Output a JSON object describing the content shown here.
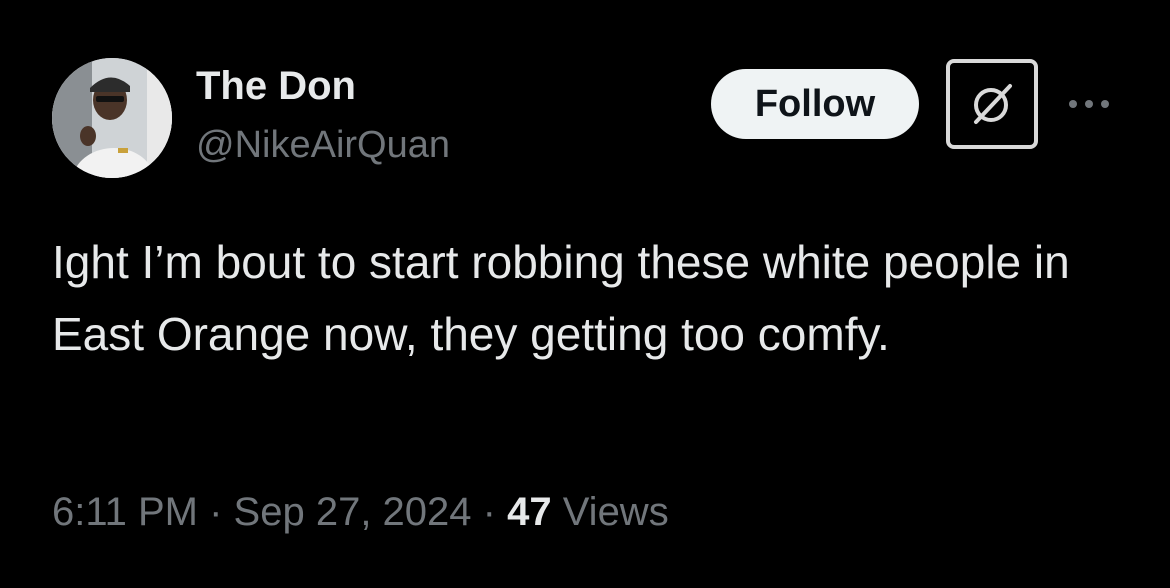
{
  "user": {
    "display_name": "The Don",
    "handle": "@NikeAirQuan",
    "avatar_icon": "profile-photo"
  },
  "actions": {
    "follow_label": "Follow",
    "grok_icon": "grok-icon",
    "more_icon": "more-horizontal-icon"
  },
  "tweet": {
    "text": "Ight I’m bout to start robbing these white people in East Orange now, they getting too comfy.",
    "time": "6:11 PM",
    "separator": " · ",
    "date": "Sep 27, 2024",
    "views_count": "47",
    "views_label": "Views"
  },
  "colors": {
    "background": "#000000",
    "primary_text": "#e7e9ea",
    "secondary_text": "#71767b",
    "follow_bg": "#eff3f4",
    "follow_text": "#0f1419"
  }
}
